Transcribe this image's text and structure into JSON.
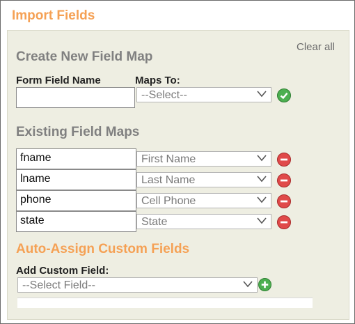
{
  "panel": {
    "title": "Import Fields",
    "clear_all": "Clear all"
  },
  "create": {
    "heading": "Create New Field Map",
    "form_field_label": "Form Field Name",
    "form_field_value": "",
    "maps_to_label": "Maps To:",
    "maps_to_value": "--Select--"
  },
  "existing": {
    "heading": "Existing Field Maps",
    "rows": [
      {
        "field": "fname",
        "maps_to": "First Name"
      },
      {
        "field": "lname",
        "maps_to": "Last Name"
      },
      {
        "field": "phone",
        "maps_to": "Cell Phone"
      },
      {
        "field": "state",
        "maps_to": "State"
      }
    ]
  },
  "auto": {
    "heading": "Auto-Assign Custom Fields",
    "add_label": "Add Custom Field:",
    "select_value": "--Select Field--"
  },
  "colors": {
    "accent": "#f5a155",
    "add": "#4caf50",
    "remove": "#e04a4a",
    "panel_bg": "#eeeee2"
  },
  "icons": {
    "confirm": "check-circle-icon",
    "remove": "minus-circle-icon",
    "add": "plus-circle-icon",
    "dropdown": "chevron-down-icon"
  }
}
